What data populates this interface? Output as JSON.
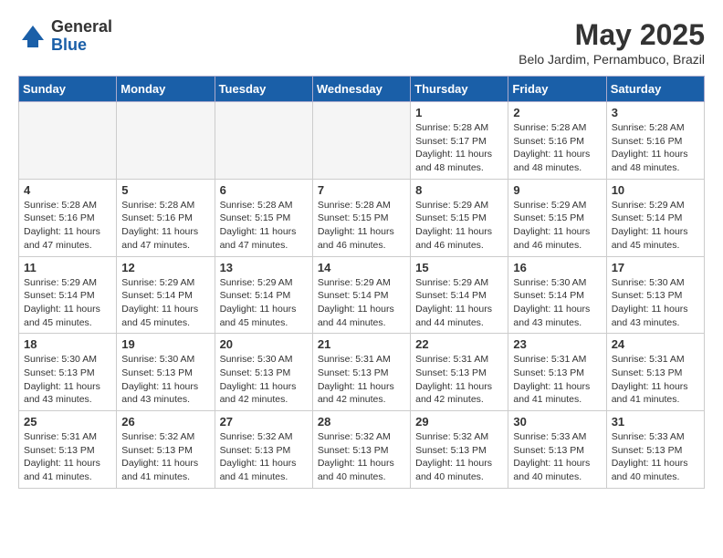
{
  "header": {
    "logo_general": "General",
    "logo_blue": "Blue",
    "month_title": "May 2025",
    "location": "Belo Jardim, Pernambuco, Brazil"
  },
  "days_of_week": [
    "Sunday",
    "Monday",
    "Tuesday",
    "Wednesday",
    "Thursday",
    "Friday",
    "Saturday"
  ],
  "weeks": [
    [
      {
        "day": "",
        "empty": true
      },
      {
        "day": "",
        "empty": true
      },
      {
        "day": "",
        "empty": true
      },
      {
        "day": "",
        "empty": true
      },
      {
        "day": "1",
        "sunrise": "5:28 AM",
        "sunset": "5:17 PM",
        "daylight": "11 hours and 48 minutes."
      },
      {
        "day": "2",
        "sunrise": "5:28 AM",
        "sunset": "5:16 PM",
        "daylight": "11 hours and 48 minutes."
      },
      {
        "day": "3",
        "sunrise": "5:28 AM",
        "sunset": "5:16 PM",
        "daylight": "11 hours and 48 minutes."
      }
    ],
    [
      {
        "day": "4",
        "sunrise": "5:28 AM",
        "sunset": "5:16 PM",
        "daylight": "11 hours and 47 minutes."
      },
      {
        "day": "5",
        "sunrise": "5:28 AM",
        "sunset": "5:16 PM",
        "daylight": "11 hours and 47 minutes."
      },
      {
        "day": "6",
        "sunrise": "5:28 AM",
        "sunset": "5:15 PM",
        "daylight": "11 hours and 47 minutes."
      },
      {
        "day": "7",
        "sunrise": "5:28 AM",
        "sunset": "5:15 PM",
        "daylight": "11 hours and 46 minutes."
      },
      {
        "day": "8",
        "sunrise": "5:29 AM",
        "sunset": "5:15 PM",
        "daylight": "11 hours and 46 minutes."
      },
      {
        "day": "9",
        "sunrise": "5:29 AM",
        "sunset": "5:15 PM",
        "daylight": "11 hours and 46 minutes."
      },
      {
        "day": "10",
        "sunrise": "5:29 AM",
        "sunset": "5:14 PM",
        "daylight": "11 hours and 45 minutes."
      }
    ],
    [
      {
        "day": "11",
        "sunrise": "5:29 AM",
        "sunset": "5:14 PM",
        "daylight": "11 hours and 45 minutes."
      },
      {
        "day": "12",
        "sunrise": "5:29 AM",
        "sunset": "5:14 PM",
        "daylight": "11 hours and 45 minutes."
      },
      {
        "day": "13",
        "sunrise": "5:29 AM",
        "sunset": "5:14 PM",
        "daylight": "11 hours and 45 minutes."
      },
      {
        "day": "14",
        "sunrise": "5:29 AM",
        "sunset": "5:14 PM",
        "daylight": "11 hours and 44 minutes."
      },
      {
        "day": "15",
        "sunrise": "5:29 AM",
        "sunset": "5:14 PM",
        "daylight": "11 hours and 44 minutes."
      },
      {
        "day": "16",
        "sunrise": "5:30 AM",
        "sunset": "5:14 PM",
        "daylight": "11 hours and 43 minutes."
      },
      {
        "day": "17",
        "sunrise": "5:30 AM",
        "sunset": "5:13 PM",
        "daylight": "11 hours and 43 minutes."
      }
    ],
    [
      {
        "day": "18",
        "sunrise": "5:30 AM",
        "sunset": "5:13 PM",
        "daylight": "11 hours and 43 minutes."
      },
      {
        "day": "19",
        "sunrise": "5:30 AM",
        "sunset": "5:13 PM",
        "daylight": "11 hours and 43 minutes."
      },
      {
        "day": "20",
        "sunrise": "5:30 AM",
        "sunset": "5:13 PM",
        "daylight": "11 hours and 42 minutes."
      },
      {
        "day": "21",
        "sunrise": "5:31 AM",
        "sunset": "5:13 PM",
        "daylight": "11 hours and 42 minutes."
      },
      {
        "day": "22",
        "sunrise": "5:31 AM",
        "sunset": "5:13 PM",
        "daylight": "11 hours and 42 minutes."
      },
      {
        "day": "23",
        "sunrise": "5:31 AM",
        "sunset": "5:13 PM",
        "daylight": "11 hours and 41 minutes."
      },
      {
        "day": "24",
        "sunrise": "5:31 AM",
        "sunset": "5:13 PM",
        "daylight": "11 hours and 41 minutes."
      }
    ],
    [
      {
        "day": "25",
        "sunrise": "5:31 AM",
        "sunset": "5:13 PM",
        "daylight": "11 hours and 41 minutes."
      },
      {
        "day": "26",
        "sunrise": "5:32 AM",
        "sunset": "5:13 PM",
        "daylight": "11 hours and 41 minutes."
      },
      {
        "day": "27",
        "sunrise": "5:32 AM",
        "sunset": "5:13 PM",
        "daylight": "11 hours and 41 minutes."
      },
      {
        "day": "28",
        "sunrise": "5:32 AM",
        "sunset": "5:13 PM",
        "daylight": "11 hours and 40 minutes."
      },
      {
        "day": "29",
        "sunrise": "5:32 AM",
        "sunset": "5:13 PM",
        "daylight": "11 hours and 40 minutes."
      },
      {
        "day": "30",
        "sunrise": "5:33 AM",
        "sunset": "5:13 PM",
        "daylight": "11 hours and 40 minutes."
      },
      {
        "day": "31",
        "sunrise": "5:33 AM",
        "sunset": "5:13 PM",
        "daylight": "11 hours and 40 minutes."
      }
    ]
  ]
}
